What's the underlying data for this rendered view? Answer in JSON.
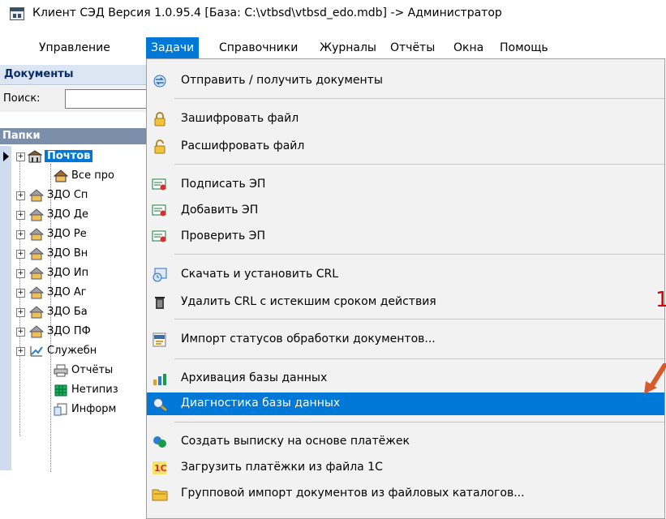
{
  "window": {
    "title": "Клиент СЭД Версия 1.0.95.4 [База: C:\\vtbsd\\vtbsd_edo.mdb] -> Администратор"
  },
  "menubar": {
    "items": [
      {
        "label": "Управление"
      },
      {
        "label": "Задачи"
      },
      {
        "label": "Справочники"
      },
      {
        "label": "Журналы"
      },
      {
        "label": "Отчёты"
      },
      {
        "label": "Окна"
      },
      {
        "label": "Помощь"
      }
    ],
    "active": "Задачи"
  },
  "left_panel": {
    "header": "Документы",
    "search_label": "Поиск:",
    "search_value": "",
    "folders_header": "Папки",
    "tree": [
      {
        "label": "Почтов",
        "selected": true
      },
      {
        "label": "Все про"
      },
      {
        "label": "ЗДО Сп"
      },
      {
        "label": "ЗДО Де"
      },
      {
        "label": "ЗДО Ре"
      },
      {
        "label": "ЗДО Вн"
      },
      {
        "label": "ЗДО Ип"
      },
      {
        "label": "ЗДО Аг"
      },
      {
        "label": "ЗДО Ба"
      },
      {
        "label": "ЗДО ПФ"
      },
      {
        "label": "Служебн"
      },
      {
        "label": "Отчёты"
      },
      {
        "label": "Нетипиз"
      },
      {
        "label": "Информ"
      }
    ]
  },
  "dropdown": {
    "items": [
      {
        "label": "Отправить / получить документы",
        "icon": "send-receive-icon"
      },
      {
        "label": "Зашифровать файл",
        "icon": "lock-icon"
      },
      {
        "label": "Расшифровать файл",
        "icon": "unlock-icon"
      },
      {
        "label": "Подписать ЭП",
        "icon": "signature-icon"
      },
      {
        "label": "Добавить ЭП",
        "icon": "signature-icon"
      },
      {
        "label": "Проверить ЭП",
        "icon": "signature-icon"
      },
      {
        "label": "Скачать и установить CRL",
        "icon": "certificate-icon"
      },
      {
        "label": "Удалить CRL с истекшим сроком действия",
        "icon": "trash-icon"
      },
      {
        "label": "Импорт статусов обработки документов...",
        "icon": "xml-import-icon"
      },
      {
        "label": "Архивация базы данных",
        "icon": "archive-icon"
      },
      {
        "label": "Диагностика базы данных",
        "icon": "diagnostics-icon",
        "highlighted": true
      },
      {
        "label": "Создать выписку на основе платёжек",
        "icon": "statement-icon"
      },
      {
        "label": "Загрузить платёжки из файла 1С",
        "icon": "import-1c-icon"
      },
      {
        "label": "Групповой импорт документов из файловых каталогов...",
        "icon": "folder-import-icon"
      }
    ]
  },
  "annotation": {
    "number": "1",
    "color": "#d80000"
  },
  "colors": {
    "highlight": "#0078d7",
    "menu_bg": "#f2f2f2"
  }
}
